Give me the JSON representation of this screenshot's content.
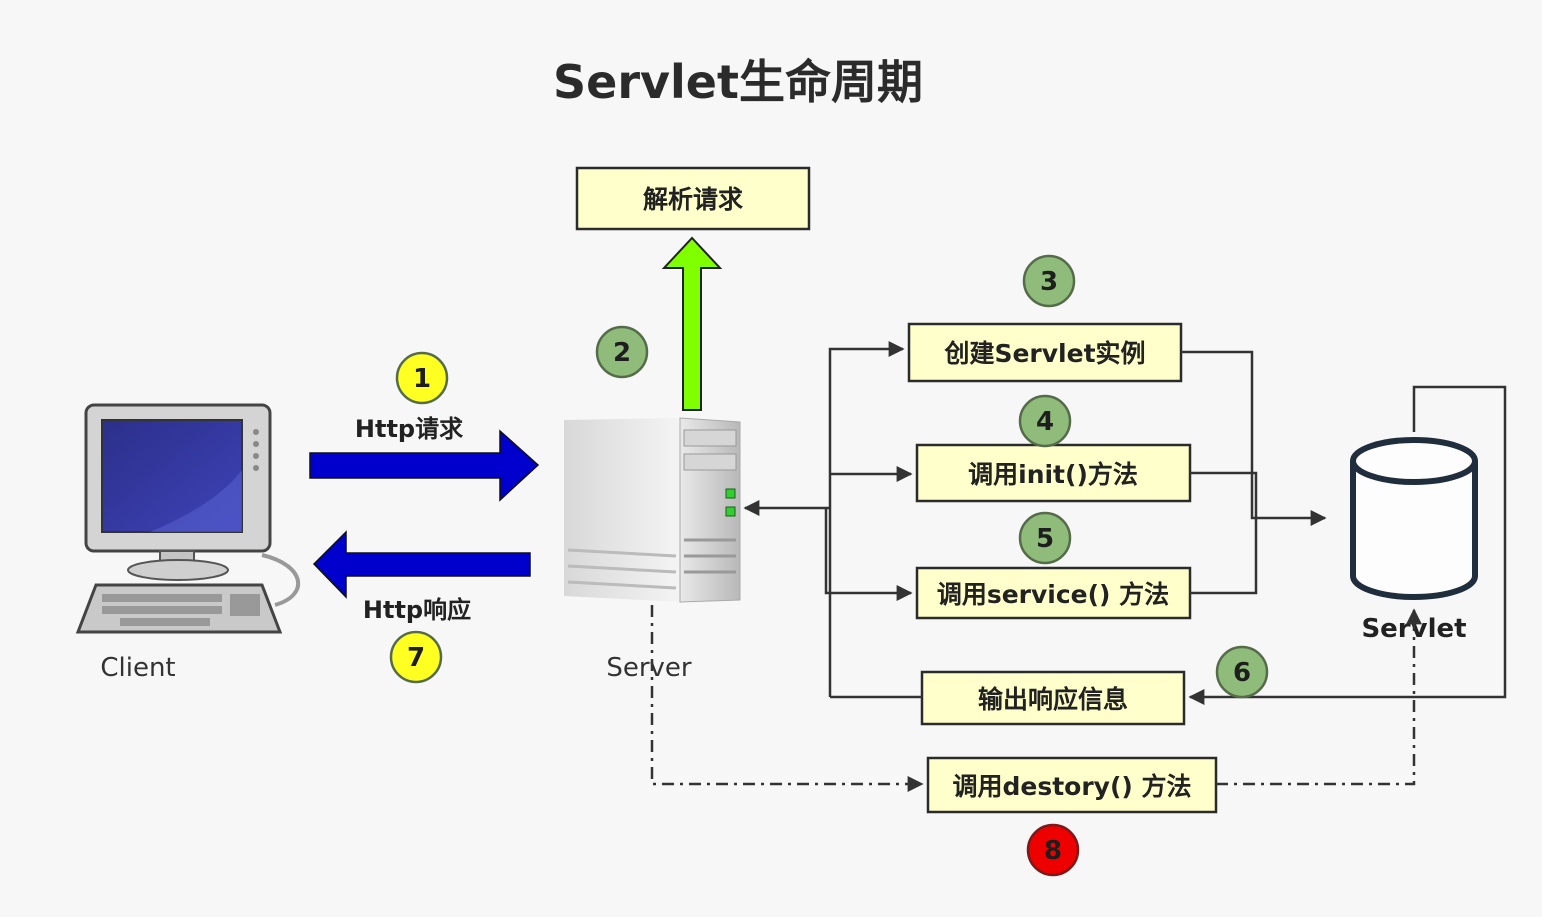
{
  "title": "Servlet生命周期",
  "nodes": {
    "client": "Client",
    "server": "Server",
    "servlet": "Servlet"
  },
  "edges": {
    "request": "Http请求",
    "response": "Http响应"
  },
  "steps": [
    {
      "id": "parse",
      "label": "解析请求"
    },
    {
      "id": "create",
      "label": "创建Servlet实例"
    },
    {
      "id": "init",
      "label": "调用init()方法"
    },
    {
      "id": "service",
      "label": "调用service() 方法"
    },
    {
      "id": "output",
      "label": "输出响应信息"
    },
    {
      "id": "destroy",
      "label": "调用destory() 方法"
    }
  ],
  "badges": [
    {
      "num": "1",
      "color": "#ffff22"
    },
    {
      "num": "2",
      "color": "#8fbc7a"
    },
    {
      "num": "3",
      "color": "#8fbc7a"
    },
    {
      "num": "4",
      "color": "#8fbc7a"
    },
    {
      "num": "5",
      "color": "#8fbc7a"
    },
    {
      "num": "6",
      "color": "#8fbc7a"
    },
    {
      "num": "7",
      "color": "#ffff22"
    },
    {
      "num": "8",
      "color": "#ee0000"
    }
  ],
  "colors": {
    "http_arrow": "#0000cc",
    "parse_arrow": "#80ff00",
    "box_fill": "#ffffcc"
  }
}
